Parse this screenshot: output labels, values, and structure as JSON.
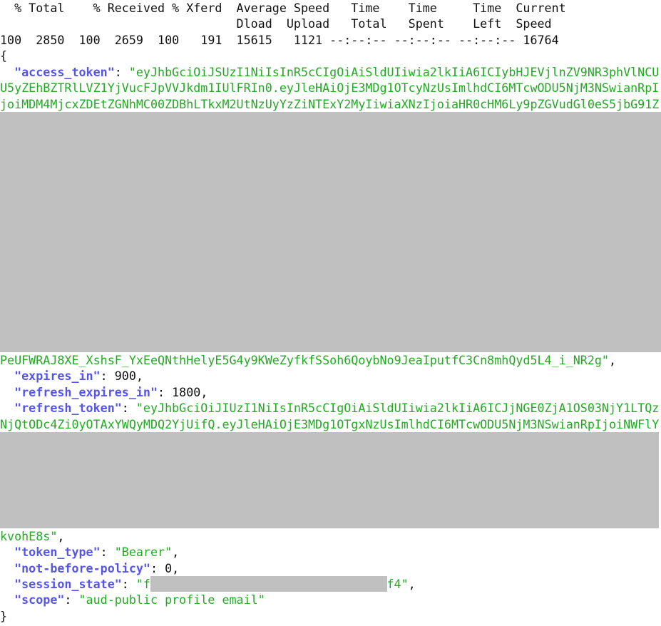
{
  "curl_progress": {
    "header_line_1": "  % Total    % Received % Xferd  Average Speed   Time    Time     Time  Current",
    "header_line_2": "                                 Dload  Upload   Total   Spent    Left  Speed",
    "stats_line": "100  2850  100  2659  100   191  15615   1121 --:--:-- --:--:-- --:--:-- 16764"
  },
  "json": {
    "open_brace": "{",
    "close_brace": "}",
    "access_token": {
      "key": "\"access_token\"",
      "value_lines": [
        "\"eyJhbGciOiJSUzI1NiIsInR5cCIgOiAiSldUIiwia2lkIiA6ICIybHJEVjlnZV9NR3phVlNCU",
        "U5yZEhBZTRlLVZ1YjVucFJpVVJkdm1IUlFRIn0.eyJleHAiOjE3MDg1OTcyNzUsImlhdCI6MTcwODU5NjM3NSwianRpI",
        "joiMDM4MjcxZDEtZGNhMC00ZDBhLTkxM2UtNzUyYzZiNTExY2MyIiwiaXNzIjoiaHR0cHM6Ly9pZGVudGl0eS5jbG91Z",
        "PeUFWRAJ8XE_XshsF_YxEeQNthHelyE5G4y9KWeZyfkfSSoh6QoybNo9JeaIputfC3Cn8mhQyd5L4_i_NR2g\""
      ]
    },
    "expires_in": {
      "key": "\"expires_in\"",
      "value": "900"
    },
    "refresh_expires_in": {
      "key": "\"refresh_expires_in\"",
      "value": "1800"
    },
    "refresh_token": {
      "key": "\"refresh_token\"",
      "value_lines": [
        "\"eyJhbGciOiJIUzI1NiIsInR5cCIgOiAiSldUIiwia2lkIiA6ICJjNGE0ZjA1OS03NjY1LTQz",
        "NjQtODc4Zi0yOTAxYWQyMDQ2YjUifQ.eyJleHAiOjE3MDg1OTgxNzUsImlhdCI6MTcwODU5NjM3NSwianRpIjoiNWFlY",
        "kvohE8s\""
      ]
    },
    "token_type": {
      "key": "\"token_type\"",
      "value": "\"Bearer\""
    },
    "not_before_policy": {
      "key": "\"not-before-policy\"",
      "value": "0"
    },
    "session_state": {
      "key": "\"session_state\"",
      "value_start": "\"f",
      "value_end": "f4\""
    },
    "scope": {
      "key": "\"scope\"",
      "value": "\"aud-public profile email\""
    }
  },
  "colors": {
    "key": "#5555ee",
    "string": "#22aa22",
    "redaction": "#c0c0c0"
  }
}
